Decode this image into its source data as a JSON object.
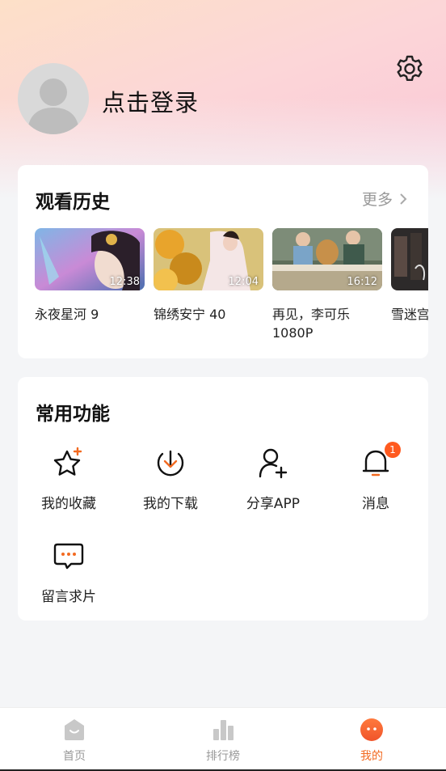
{
  "header": {
    "login_label": "点击登录"
  },
  "history": {
    "title": "观看历史",
    "more_label": "更多",
    "items": [
      {
        "title": "永夜星河 9",
        "duration": "12:38"
      },
      {
        "title": "锦绣安宁 40",
        "duration": "12:04"
      },
      {
        "title": "再见，李可乐 1080P",
        "duration": "16:12"
      },
      {
        "title": "雪迷宫",
        "duration": ""
      }
    ]
  },
  "functions": {
    "title": "常用功能",
    "items": [
      {
        "label": "我的收藏",
        "icon": "star-icon"
      },
      {
        "label": "我的下载",
        "icon": "download-icon"
      },
      {
        "label": "分享APP",
        "icon": "add-user-icon"
      },
      {
        "label": "消息",
        "icon": "bell-icon",
        "badge": "1"
      },
      {
        "label": "留言求片",
        "icon": "message-icon"
      }
    ]
  },
  "nav": {
    "items": [
      {
        "label": "首页",
        "icon": "home-icon",
        "active": false
      },
      {
        "label": "排行榜",
        "icon": "ranking-icon",
        "active": false
      },
      {
        "label": "我的",
        "icon": "profile-icon",
        "active": true
      }
    ]
  },
  "colors": {
    "accent": "#f26a21",
    "badge": "#ff5a1f"
  }
}
